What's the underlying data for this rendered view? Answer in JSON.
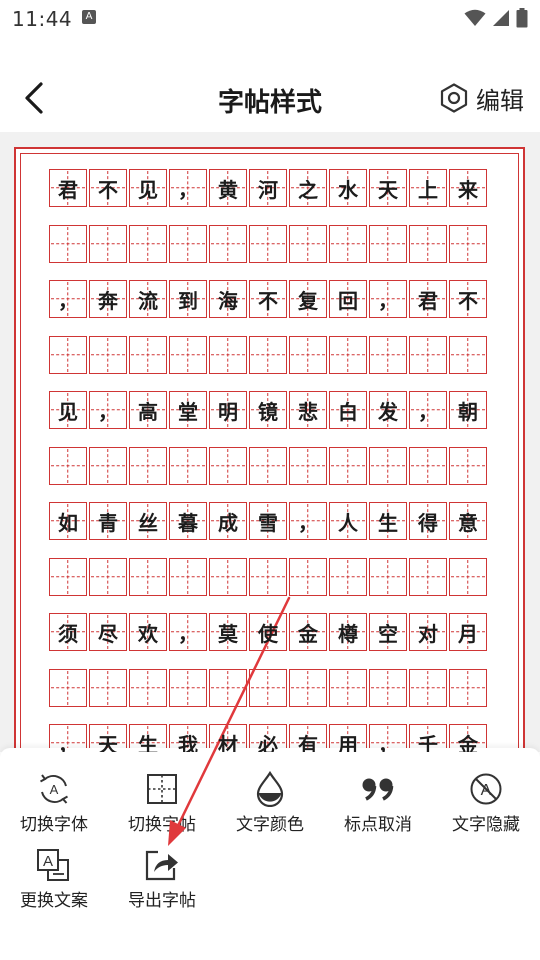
{
  "status": {
    "time": "11:44",
    "notification_badge": "A"
  },
  "header": {
    "title": "字帖样式",
    "edit_label": "编辑"
  },
  "copybook": {
    "rows": [
      [
        "君",
        "不",
        "见",
        "，",
        "黄",
        "河",
        "之",
        "水",
        "天",
        "上",
        "来"
      ],
      [
        "",
        "",
        "",
        "",
        "",
        "",
        "",
        "",
        "",
        "",
        ""
      ],
      [
        "，",
        "奔",
        "流",
        "到",
        "海",
        "不",
        "复",
        "回",
        "，",
        "君",
        "不"
      ],
      [
        "",
        "",
        "",
        "",
        "",
        "",
        "",
        "",
        "",
        "",
        ""
      ],
      [
        "见",
        "，",
        "高",
        "堂",
        "明",
        "镜",
        "悲",
        "白",
        "发",
        "，",
        "朝"
      ],
      [
        "",
        "",
        "",
        "",
        "",
        "",
        "",
        "",
        "",
        "",
        ""
      ],
      [
        "如",
        "青",
        "丝",
        "暮",
        "成",
        "雪",
        "，",
        "人",
        "生",
        "得",
        "意"
      ],
      [
        "",
        "",
        "",
        "",
        "",
        "",
        "",
        "",
        "",
        "",
        ""
      ],
      [
        "须",
        "尽",
        "欢",
        "，",
        "莫",
        "使",
        "金",
        "樽",
        "空",
        "对",
        "月"
      ],
      [
        "",
        "",
        "",
        "",
        "",
        "",
        "",
        "",
        "",
        "",
        ""
      ],
      [
        "，",
        "天",
        "生",
        "我",
        "材",
        "必",
        "有",
        "用",
        "，",
        "千",
        "金"
      ]
    ],
    "grid_color": "#cf3535"
  },
  "toolbar": {
    "items": [
      {
        "label": "切换字体",
        "icon": "font-switch-icon"
      },
      {
        "label": "切换字帖",
        "icon": "grid-switch-icon"
      },
      {
        "label": "文字颜色",
        "icon": "drop-icon"
      },
      {
        "label": "标点取消",
        "icon": "quote-icon"
      },
      {
        "label": "文字隐藏",
        "icon": "hide-text-icon"
      },
      {
        "label": "更换文案",
        "icon": "replace-text-icon"
      },
      {
        "label": "导出字帖",
        "icon": "export-icon"
      }
    ]
  },
  "annotation": {
    "arrow_color": "#e0393c"
  }
}
